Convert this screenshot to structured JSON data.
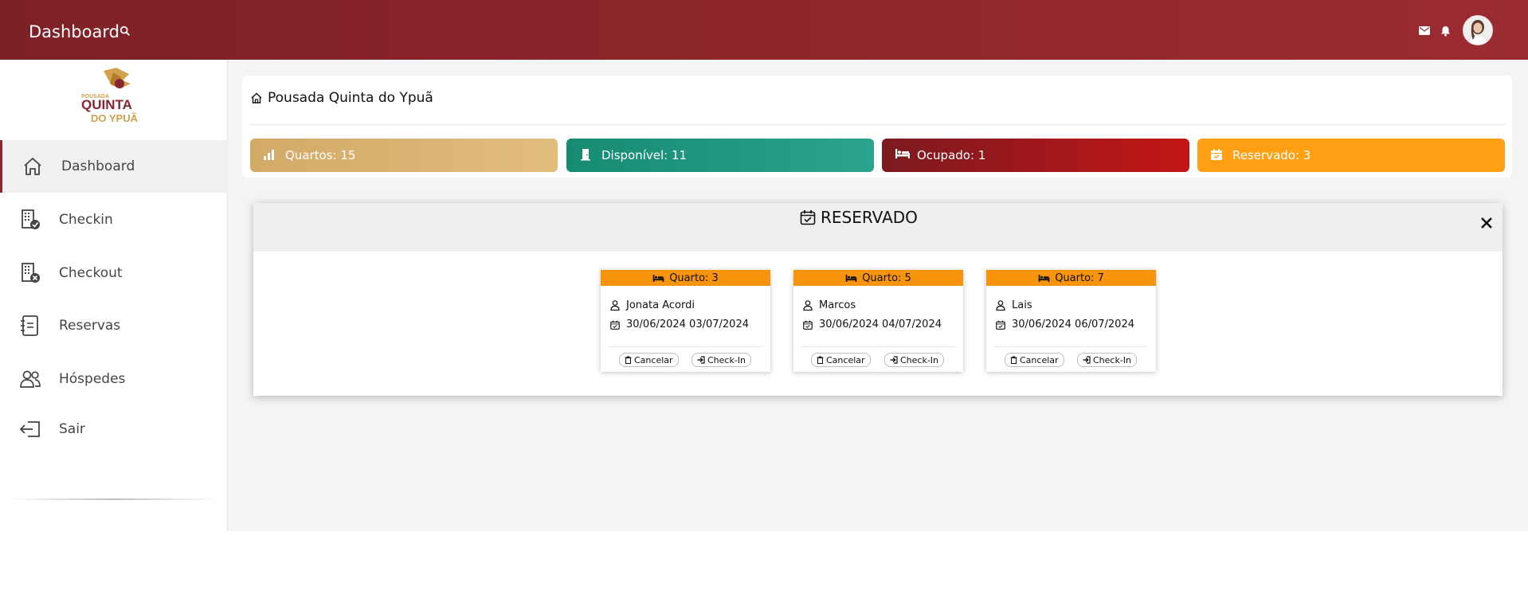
{
  "topbar": {
    "title": "Dashboard",
    "icons": [
      "search-icon",
      "mail-icon",
      "bell-icon"
    ],
    "avatar": "user-avatar"
  },
  "logo": {
    "line1": "POUSADA",
    "line2": "QUINTA",
    "line3": "DO YPUÃ"
  },
  "sidebar": {
    "items": [
      {
        "label": "Dashboard",
        "icon": "home-icon",
        "active": true
      },
      {
        "label": "Checkin",
        "icon": "building-check-icon"
      },
      {
        "label": "Checkout",
        "icon": "building-x-icon"
      },
      {
        "label": "Reservas",
        "icon": "journal-icon"
      },
      {
        "label": "Hóspedes",
        "icon": "people-icon"
      },
      {
        "label": "Sair",
        "icon": "logout-icon"
      }
    ]
  },
  "breadcrumb": {
    "label": "Pousada Quinta do Ypuã"
  },
  "stats": [
    {
      "label": "Quartos: 15",
      "icon": "bar-chart-icon",
      "color": "#d8b06a"
    },
    {
      "label": "Disponível: 11",
      "icon": "door-icon",
      "color": "#1e9478"
    },
    {
      "label": "Ocupado: 1",
      "icon": "bed-icon",
      "color": "#8e1e20"
    },
    {
      "label": "Reservado: 3",
      "icon": "calendar-check-icon",
      "color": "#ffa014"
    }
  ],
  "modal": {
    "title": "RESERVADO",
    "rooms": [
      {
        "room": "Quarto: 3",
        "guest": "Jonata Acordi",
        "dates": "30/06/2024 03/07/2024",
        "cancel": "Cancelar",
        "checkin": "Check-In"
      },
      {
        "room": "Quarto: 5",
        "guest": "Marcos",
        "dates": "30/06/2024 04/07/2024",
        "cancel": "Cancelar",
        "checkin": "Check-In"
      },
      {
        "room": "Quarto: 7",
        "guest": "Lais",
        "dates": "30/06/2024 06/07/2024",
        "cancel": "Cancelar",
        "checkin": "Check-In"
      }
    ]
  }
}
